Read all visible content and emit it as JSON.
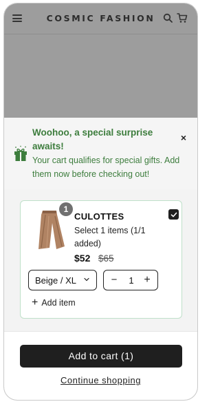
{
  "header": {
    "brand": "COSMIC FASHION",
    "icons": [
      "hamburger-menu-icon",
      "search-icon",
      "cart-icon"
    ]
  },
  "banner": {
    "title": "Woohoo, a special surprise awaits!",
    "text": "Your cart qualifies for special gifts. Add them now before checking out!",
    "icon": "gift-icon",
    "close_label": "×"
  },
  "product": {
    "badge": "1",
    "name": "CULOTTES",
    "note": "Select 1 items (1/1 added)",
    "price": "$52",
    "old_price": "$65",
    "variant": "Beige / XL",
    "quantity": "1",
    "checked": true,
    "add_item_label": "Add item"
  },
  "footer": {
    "cta_label": "Add to cart (1)",
    "continue_label": "Continue shopping"
  },
  "colors": {
    "accent_green": "#3d7d3d",
    "overlay": "#9d9d9d",
    "button_dark": "#1f1f1f"
  }
}
